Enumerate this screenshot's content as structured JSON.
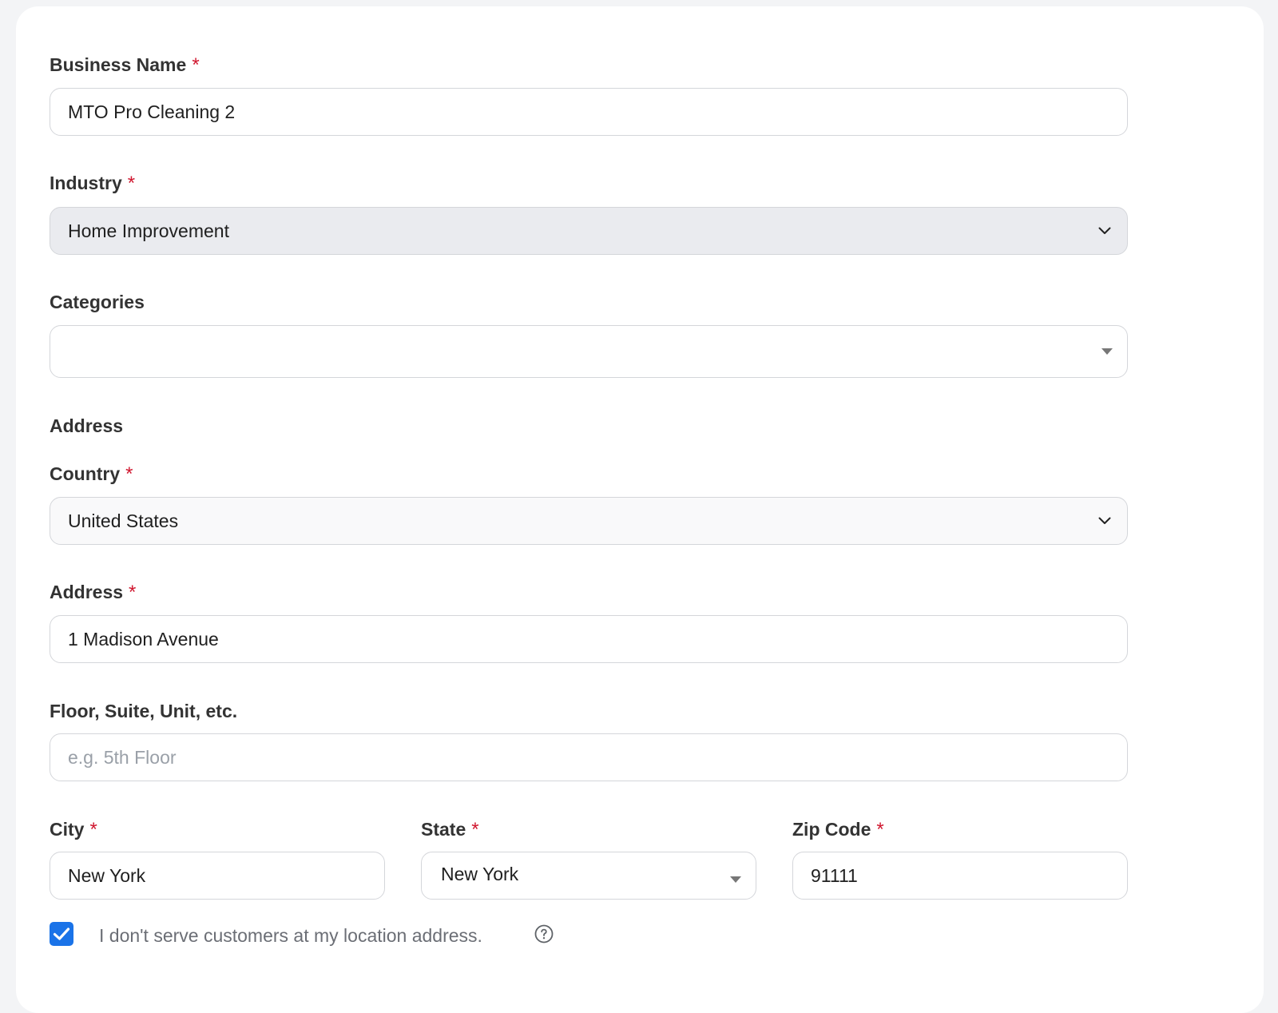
{
  "form": {
    "business_name": {
      "label": "Business Name",
      "required": "*",
      "value": "MTO Pro Cleaning 2"
    },
    "industry": {
      "label": "Industry",
      "required": "*",
      "value": "Home Improvement"
    },
    "categories": {
      "label": "Categories",
      "value": ""
    },
    "address_section": {
      "label": "Address"
    },
    "country": {
      "label": "Country",
      "required": "*",
      "value": "United States"
    },
    "address": {
      "label": "Address",
      "required": "*",
      "value": "1 Madison Avenue"
    },
    "floor": {
      "label": "Floor, Suite, Unit, etc.",
      "placeholder": "e.g. 5th Floor"
    },
    "city": {
      "label": "City",
      "required": "*",
      "value": "New York"
    },
    "state": {
      "label": "State",
      "required": "*",
      "value": "New York"
    },
    "zip": {
      "label": "Zip Code",
      "required": "*",
      "value": "91111"
    },
    "no_customers": {
      "label": "I don't serve customers at my location address.",
      "checked": true
    }
  },
  "colors": {
    "required": "#d0172f",
    "checkbox": "#1a73e8",
    "industry_bg": "#eaebef"
  },
  "icons": {
    "dropdown": "chevron-down-icon",
    "caret": "caret-down-icon",
    "check": "check-icon",
    "help": "question-circle-icon"
  }
}
